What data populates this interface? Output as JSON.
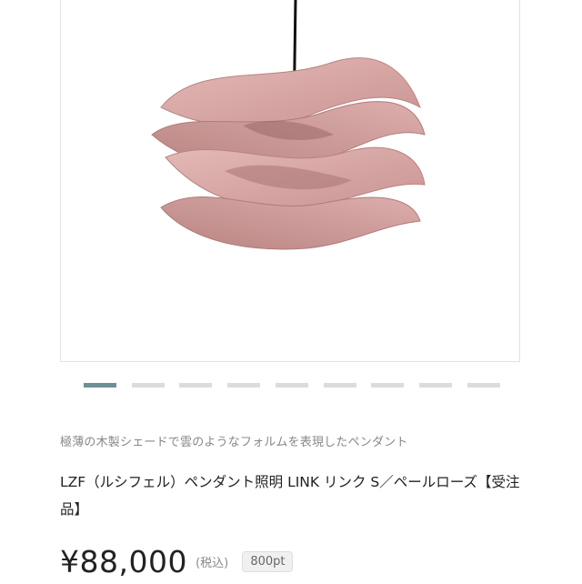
{
  "product": {
    "image_alt_icon": "pendant-lamp-image",
    "tagline": "極薄の木製シェードで雲のようなフォルムを表現したペンダント",
    "title": "LZF（ルシフェル）ペンダント照明 LINK リンク S／ペールローズ【受注品】",
    "price": "¥88,000",
    "tax_note": "(税込)",
    "points": "800pt"
  },
  "carousel": {
    "count": 9,
    "active_index": 0,
    "active_color": "#6f8f97",
    "inactive_color": "#dcdcdc"
  },
  "colors": {
    "shade": "#d9a8a6",
    "shade_dark": "#b98482",
    "cord": "#111111"
  }
}
